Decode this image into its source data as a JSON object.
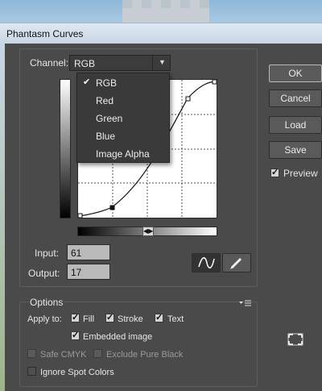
{
  "window": {
    "title": "Phantasm Curves"
  },
  "channel": {
    "label": "Channel:",
    "selected": "RGB",
    "options": [
      {
        "label": "RGB",
        "checked": true
      },
      {
        "label": "Red",
        "checked": false
      },
      {
        "label": "Green",
        "checked": false
      },
      {
        "label": "Blue",
        "checked": false
      },
      {
        "label": "Image Alpha",
        "checked": false
      }
    ]
  },
  "curve": {
    "input_label": "Input:",
    "input_value": "61",
    "output_label": "Output:",
    "output_value": "17",
    "tools": {
      "curve_icon": "smooth-curve-icon",
      "pencil_icon": "pencil-icon",
      "active": "curve"
    }
  },
  "buttons": {
    "ok": "OK",
    "cancel": "Cancel",
    "load": "Load",
    "save": "Save"
  },
  "preview": {
    "label": "Preview",
    "checked": true
  },
  "options": {
    "title": "Options",
    "apply_to_label": "Apply to:",
    "fill": {
      "label": "Fill",
      "checked": true
    },
    "stroke": {
      "label": "Stroke",
      "checked": true
    },
    "text": {
      "label": "Text",
      "checked": true
    },
    "embedded_image": {
      "label": "Embedded image",
      "checked": true
    },
    "safe_cmyk": {
      "label": "Safe CMYK",
      "checked": false,
      "enabled": false
    },
    "exclude_pure_black": {
      "label": "Exclude Pure Black",
      "checked": false,
      "enabled": false
    },
    "ignore_spot_colors": {
      "label": "Ignore Spot Colors",
      "checked": false,
      "enabled": true
    },
    "flyout_icon": "panel-menu-icon"
  },
  "expand_icon": "fit-to-window-icon",
  "colors": {
    "dialog_bg": "#4a4a4a",
    "field_bg": "#b9b9b9",
    "menu_bg": "#3a3a3a"
  }
}
